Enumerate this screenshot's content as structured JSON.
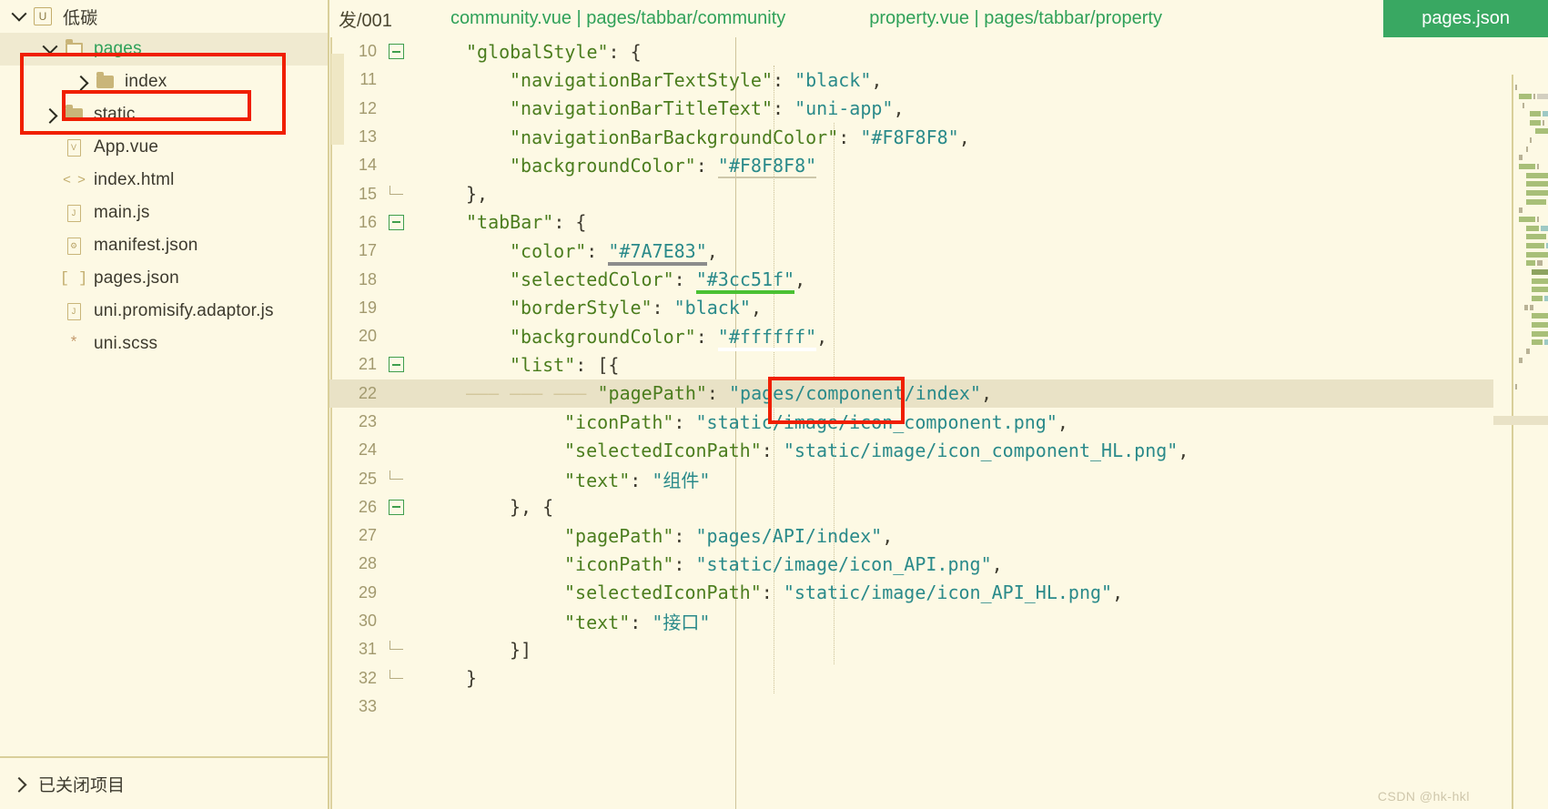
{
  "sidebar": {
    "project": {
      "label": "低碳",
      "icon": "uniapp-logo-icon",
      "expanded_icon": "chevron-down-icon"
    },
    "items": [
      {
        "label": "pages",
        "icon": "folder-open-icon",
        "twisty": "chevron-down-icon",
        "depth": 1,
        "selected": true,
        "highlight": true
      },
      {
        "label": "index",
        "icon": "folder-icon",
        "twisty": "chevron-right-icon",
        "depth": 2,
        "selected": false,
        "highlight": false
      },
      {
        "label": "static",
        "icon": "folder-icon",
        "twisty": "chevron-right-icon",
        "depth": 1,
        "selected": false,
        "highlight": false
      },
      {
        "label": "App.vue",
        "icon": "vue-file-icon",
        "twisty": "",
        "depth": 2,
        "selected": false,
        "highlight": false
      },
      {
        "label": "index.html",
        "icon": "html-file-icon",
        "twisty": "",
        "depth": 2,
        "selected": false,
        "highlight": false
      },
      {
        "label": "main.js",
        "icon": "js-file-icon",
        "twisty": "",
        "depth": 2,
        "selected": false,
        "highlight": false
      },
      {
        "label": "manifest.json",
        "icon": "manifest-file-icon",
        "twisty": "",
        "depth": 2,
        "selected": false,
        "highlight": false
      },
      {
        "label": "pages.json",
        "icon": "json-file-icon",
        "twisty": "",
        "depth": 2,
        "selected": false,
        "highlight": false
      },
      {
        "label": "uni.promisify.adaptor.js",
        "icon": "js-file-icon",
        "twisty": "",
        "depth": 2,
        "selected": false,
        "highlight": false
      },
      {
        "label": "uni.scss",
        "icon": "sass-file-icon",
        "twisty": "",
        "depth": 2,
        "selected": false,
        "highlight": false
      }
    ],
    "closed_projects": {
      "label": "已关闭项目",
      "twisty": "chevron-right-icon"
    }
  },
  "tabs": [
    {
      "label": "发/001",
      "active": false,
      "kind": "truncated"
    },
    {
      "label": "community.vue | pages/tabbar/community",
      "active": false,
      "kind": "normal"
    },
    {
      "label": "property.vue | pages/tabbar/property",
      "active": false,
      "kind": "normal"
    },
    {
      "label": "pages.json",
      "active": true,
      "kind": "normal"
    }
  ],
  "editor": {
    "current_line": 22,
    "first_line": 10,
    "last_line": 33,
    "lines": [
      {
        "n": 10,
        "fold": "minus",
        "indent": 1,
        "text": "\"globalStyle\": {"
      },
      {
        "n": 11,
        "fold": "",
        "indent": 2,
        "text": "\"navigationBarTextStyle\": \"black\","
      },
      {
        "n": 12,
        "fold": "",
        "indent": 2,
        "text": "\"navigationBarTitleText\": \"uni-app\","
      },
      {
        "n": 13,
        "fold": "",
        "indent": 2,
        "text": "\"navigationBarBackgroundColor\": \"#F8F8F8\","
      },
      {
        "n": 14,
        "fold": "",
        "indent": 2,
        "text": "\"backgroundColor\": \"#F8F8F8\""
      },
      {
        "n": 15,
        "fold": "end",
        "indent": 1,
        "text": "},"
      },
      {
        "n": 16,
        "fold": "minus",
        "indent": 1,
        "text": "\"tabBar\": {"
      },
      {
        "n": 17,
        "fold": "",
        "indent": 2,
        "text": "\"color\": \"#7A7E83\","
      },
      {
        "n": 18,
        "fold": "",
        "indent": 2,
        "text": "\"selectedColor\": \"#3cc51f\","
      },
      {
        "n": 19,
        "fold": "",
        "indent": 2,
        "text": "\"borderStyle\": \"black\","
      },
      {
        "n": 20,
        "fold": "",
        "indent": 2,
        "text": "\"backgroundColor\": \"#ffffff\","
      },
      {
        "n": 21,
        "fold": "minus",
        "indent": 2,
        "text": "\"list\": [{"
      },
      {
        "n": 22,
        "fold": "",
        "indent": 3,
        "text": "\"pagePath\": \"pages/component/index\","
      },
      {
        "n": 23,
        "fold": "",
        "indent": 3,
        "text": "\"iconPath\": \"static/image/icon_component.png\","
      },
      {
        "n": 24,
        "fold": "",
        "indent": 3,
        "text": "\"selectedIconPath\": \"static/image/icon_component_HL.png\","
      },
      {
        "n": 25,
        "fold": "end",
        "indent": 3,
        "text": "\"text\": \"组件\""
      },
      {
        "n": 26,
        "fold": "minus",
        "indent": 2,
        "text": "}, {"
      },
      {
        "n": 27,
        "fold": "",
        "indent": 3,
        "text": "\"pagePath\": \"pages/API/index\","
      },
      {
        "n": 28,
        "fold": "",
        "indent": 3,
        "text": "\"iconPath\": \"static/image/icon_API.png\","
      },
      {
        "n": 29,
        "fold": "",
        "indent": 3,
        "text": "\"selectedIconPath\": \"static/image/icon_API_HL.png\","
      },
      {
        "n": 30,
        "fold": "",
        "indent": 3,
        "text": "\"text\": \"接口\""
      },
      {
        "n": 31,
        "fold": "end",
        "indent": 2,
        "text": "}]"
      },
      {
        "n": 32,
        "fold": "end",
        "indent": 1,
        "text": "}"
      },
      {
        "n": 33,
        "fold": "",
        "indent": 0,
        "text": ""
      }
    ],
    "color_swatches": [
      {
        "line": 17,
        "value": "#7A7E83"
      },
      {
        "line": 18,
        "value": "#3cc51f"
      },
      {
        "line": 20,
        "value": "#ffffff"
      }
    ]
  },
  "annotations": [
    {
      "name": "pages-folder-highlight",
      "shape": "rect"
    },
    {
      "name": "index-folder-highlight",
      "shape": "rect"
    },
    {
      "name": "component-path-highlight",
      "shape": "rect"
    }
  ],
  "watermark": "CSDN @hk-hkl",
  "colors": {
    "background": "#fdf9e4",
    "accent_green": "#39a862",
    "tab_text_green": "#2fa159",
    "key_green": "#4b7d1e",
    "string_teal": "#2a8a8a",
    "annotation_red": "#f01f00",
    "current_line": "#e9e2c6"
  }
}
